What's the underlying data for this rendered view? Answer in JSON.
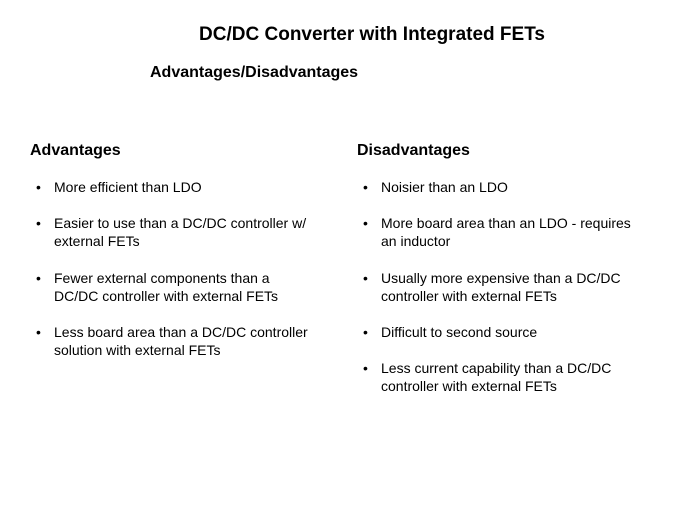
{
  "title": "DC/DC Converter with Integrated FETs",
  "subtitle": "Advantages/Disadvantages",
  "advantages": {
    "heading": "Advantages",
    "items": [
      "More efficient than LDO",
      "Easier to use than a DC/DC controller w/ external FETs",
      "Fewer external components than a DC/DC controller with external FETs",
      "Less board area than a DC/DC controller solution with external FETs"
    ]
  },
  "disadvantages": {
    "heading": "Disadvantages",
    "items": [
      "Noisier than an LDO",
      "More board area than an LDO - requires an inductor",
      "Usually more expensive than a DC/DC controller with external FETs",
      "Difficult  to second source",
      "Less current capability than a DC/DC controller with external FETs"
    ]
  }
}
